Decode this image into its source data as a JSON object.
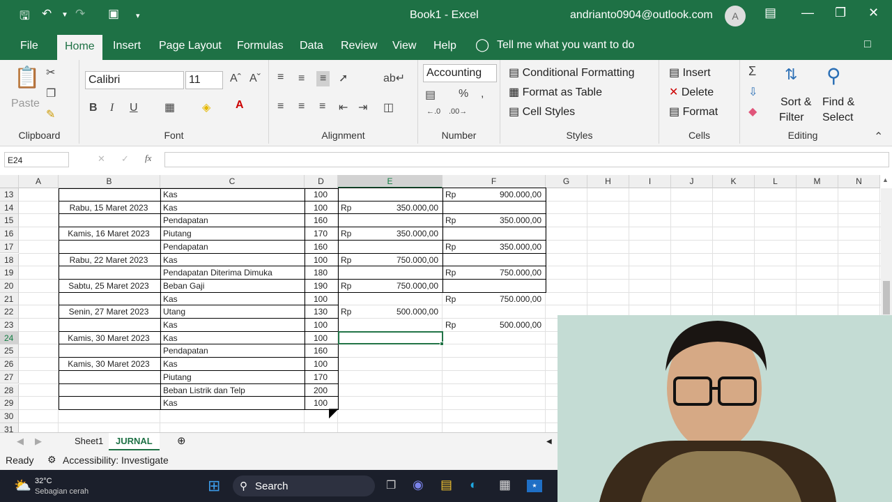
{
  "title_bar": {
    "document_title": "Book1  -  Excel",
    "account": "andrianto0904@outlook.com",
    "avatar_initial": "A"
  },
  "ribbon_tabs": [
    "File",
    "Home",
    "Insert",
    "Page Layout",
    "Formulas",
    "Data",
    "Review",
    "View",
    "Help"
  ],
  "tell_me": "Tell me what you want to do",
  "ribbon": {
    "clipboard": {
      "label": "Clipboard",
      "paste": "Paste"
    },
    "font": {
      "label": "Font",
      "name": "Calibri",
      "size": "11"
    },
    "alignment": {
      "label": "Alignment"
    },
    "number": {
      "label": "Number",
      "format": "Accounting"
    },
    "styles": {
      "label": "Styles",
      "conditional": "Conditional Formatting",
      "format_table": "Format as Table",
      "cell_styles": "Cell Styles"
    },
    "cells": {
      "label": "Cells",
      "insert": "Insert",
      "delete": "Delete",
      "format": "Format"
    },
    "editing": {
      "label": "Editing",
      "sort": "Sort &",
      "filter": "Filter",
      "find": "Find &",
      "select": "Select"
    }
  },
  "name_box": "E24",
  "columns": [
    "A",
    "B",
    "C",
    "D",
    "E",
    "F",
    "G",
    "H",
    "I",
    "J",
    "K",
    "L",
    "M",
    "N"
  ],
  "rows": [
    {
      "n": "13",
      "b": "",
      "c": "Kas",
      "d": "100",
      "e_rp": "",
      "e": "",
      "f_rp": "Rp",
      "f": "900.000,00"
    },
    {
      "n": "14",
      "b": "Rabu, 15 Maret 2023",
      "c": "Kas",
      "d": "100",
      "e_rp": "Rp",
      "e": "350.000,00",
      "f_rp": "",
      "f": ""
    },
    {
      "n": "15",
      "b": "",
      "c": "Pendapatan",
      "d": "160",
      "e_rp": "",
      "e": "",
      "f_rp": "Rp",
      "f": "350.000,00"
    },
    {
      "n": "16",
      "b": "Kamis, 16 Maret 2023",
      "c": "Piutang",
      "d": "170",
      "e_rp": "Rp",
      "e": "350.000,00",
      "f_rp": "",
      "f": ""
    },
    {
      "n": "17",
      "b": "",
      "c": "Pendapatan",
      "d": "160",
      "e_rp": "",
      "e": "",
      "f_rp": "Rp",
      "f": "350.000,00"
    },
    {
      "n": "18",
      "b": "Rabu, 22 Maret 2023",
      "c": "Kas",
      "d": "100",
      "e_rp": "Rp",
      "e": "750.000,00",
      "f_rp": "",
      "f": ""
    },
    {
      "n": "19",
      "b": "",
      "c": "Pendapatan Diterima Dimuka",
      "d": "180",
      "e_rp": "",
      "e": "",
      "f_rp": "Rp",
      "f": "750.000,00"
    },
    {
      "n": "20",
      "b": "Sabtu, 25 Maret 2023",
      "c": "Beban Gaji",
      "d": "190",
      "e_rp": "Rp",
      "e": "750.000,00",
      "f_rp": "",
      "f": ""
    },
    {
      "n": "21",
      "b": "",
      "c": "Kas",
      "d": "100",
      "e_rp": "",
      "e": "",
      "f_rp": "Rp",
      "f": "750.000,00"
    },
    {
      "n": "22",
      "b": "Senin, 27 Maret 2023",
      "c": "Utang",
      "d": "130",
      "e_rp": "Rp",
      "e": "500.000,00",
      "f_rp": "",
      "f": ""
    },
    {
      "n": "23",
      "b": "",
      "c": "Kas",
      "d": "100",
      "e_rp": "",
      "e": "",
      "f_rp": "Rp",
      "f": "500.000,00"
    },
    {
      "n": "24",
      "b": "Kamis, 30 Maret 2023",
      "c": "Kas",
      "d": "100",
      "e_rp": "",
      "e": "",
      "f_rp": "",
      "f": ""
    },
    {
      "n": "25",
      "b": "",
      "c": "Pendapatan",
      "d": "160",
      "e_rp": "",
      "e": "",
      "f_rp": "",
      "f": ""
    },
    {
      "n": "26",
      "b": "Kamis, 30 Maret 2023",
      "c": "Kas",
      "d": "100",
      "e_rp": "",
      "e": "",
      "f_rp": "",
      "f": ""
    },
    {
      "n": "27",
      "b": "",
      "c": "Piutang",
      "d": "170",
      "e_rp": "",
      "e": "",
      "f_rp": "",
      "f": ""
    },
    {
      "n": "28",
      "b": "",
      "c": "Beban Listrik dan Telp",
      "d": "200",
      "e_rp": "",
      "e": "",
      "f_rp": "",
      "f": ""
    },
    {
      "n": "29",
      "b": "",
      "c": "Kas",
      "d": "100",
      "e_rp": "",
      "e": "",
      "f_rp": "",
      "f": ""
    },
    {
      "n": "30",
      "b": "",
      "c": "",
      "d": "",
      "e_rp": "",
      "e": "",
      "f_rp": "",
      "f": ""
    },
    {
      "n": "31",
      "b": "",
      "c": "",
      "d": "",
      "e_rp": "",
      "e": "",
      "f_rp": "",
      "f": ""
    }
  ],
  "sheet_tabs": [
    "Sheet1",
    "JURNAL"
  ],
  "status": {
    "ready": "Ready",
    "accessibility": "Accessibility: Investigate"
  },
  "taskbar": {
    "temp": "32°C",
    "weather": "Sebagian cerah",
    "search": "Search"
  },
  "colors": {
    "excel_green": "#1e7145",
    "selection_green": "#217346"
  }
}
